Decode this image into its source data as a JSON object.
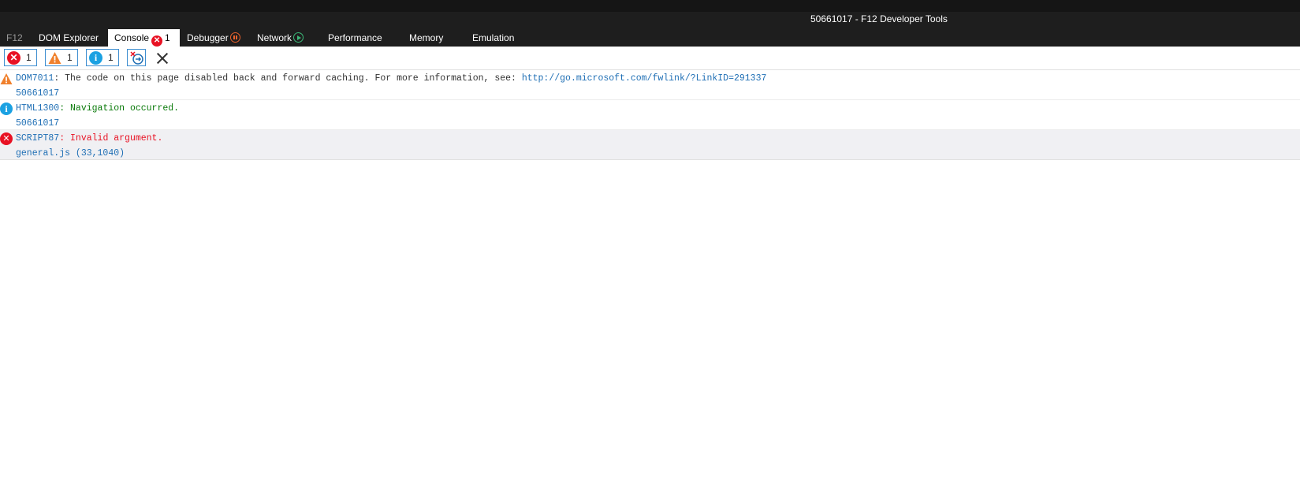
{
  "window": {
    "title": "50661017 - F12 Developer Tools"
  },
  "tabs": {
    "f12": "F12",
    "dom_explorer": "DOM Explorer",
    "console": "Console",
    "console_error_count": "1",
    "debugger": "Debugger",
    "network": "Network",
    "performance": "Performance",
    "memory": "Memory",
    "emulation": "Emulation"
  },
  "toolbar": {
    "errors_count": "1",
    "warnings_count": "1",
    "messages_count": "1"
  },
  "colors": {
    "error": "#e81123",
    "warning": "#f0802c",
    "info": "#1ba1e2",
    "link": "#1f6fb5",
    "info_text": "#0a7a0a",
    "tab_bar_bg": "#1e1e1e"
  },
  "messages": [
    {
      "type": "warning",
      "icon": "warning-icon",
      "code": "DOM7011",
      "separator": ": ",
      "text": "The code on this page disabled back and forward caching. For more information, see: ",
      "link": "http://go.microsoft.com/fwlink/?LinkID=291337",
      "source": "50661017"
    },
    {
      "type": "info",
      "icon": "info-icon",
      "code": "HTML1300",
      "separator": ": ",
      "text": "Navigation occurred.",
      "source": "50661017"
    },
    {
      "type": "error",
      "icon": "error-icon",
      "code": "SCRIPT87",
      "separator": ": ",
      "text": "Invalid argument.",
      "source": "general.js (33,1040)"
    }
  ]
}
